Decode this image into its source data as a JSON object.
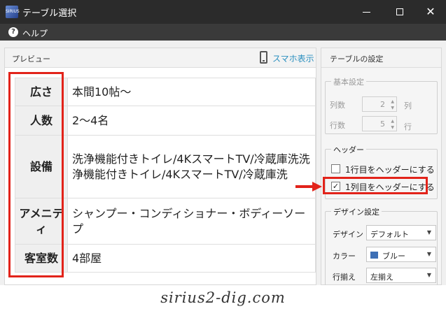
{
  "window": {
    "app_icon_text": "SIRIUS",
    "title": "テーブル選択",
    "minimize_icon": "minimize-icon",
    "maximize_icon": "maximize-icon",
    "close_icon": "close-icon",
    "close_glyph": "✕"
  },
  "menu": {
    "help_icon_glyph": "?",
    "help_label": "ヘルプ"
  },
  "preview": {
    "title": "プレビュー",
    "smartphone_label": "スマホ表示",
    "rows": [
      {
        "header": "広さ",
        "value": "本間10帖～"
      },
      {
        "header": "人数",
        "value": "2～4名"
      },
      {
        "header": "設備",
        "value": "洗浄機能付きトイレ/4KスマートTV/冷蔵庫洗洗浄機能付きトイレ/4KスマートTV/冷蔵庫洗"
      },
      {
        "header": "アメニティ",
        "value": "シャンプー・コンディショナー・ボディーソープ"
      },
      {
        "header": "客室数",
        "value": "4部屋"
      }
    ]
  },
  "settings": {
    "title": "テーブルの設定",
    "basic": {
      "legend": "基本設定",
      "columns_label": "列数",
      "columns_value": "2",
      "columns_unit": "列",
      "rows_label": "行数",
      "rows_value": "5",
      "rows_unit": "行"
    },
    "header": {
      "legend": "ヘッダー",
      "first_row_label": "1行目をヘッダーにする",
      "first_row_checked": false,
      "first_col_label": "1列目をヘッダーにする",
      "first_col_checked": true,
      "check_glyph": "✓"
    },
    "design": {
      "legend": "デザイン設定",
      "design_label": "デザイン",
      "design_value": "デフォルト",
      "color_label": "カラー",
      "color_value": "ブルー",
      "color_swatch": "#3d6fb5",
      "align_label": "行揃え",
      "align_value": "左揃え"
    }
  },
  "annotations": {
    "highlight_color": "#e2231a"
  },
  "watermark": "sirius2-dig.com"
}
